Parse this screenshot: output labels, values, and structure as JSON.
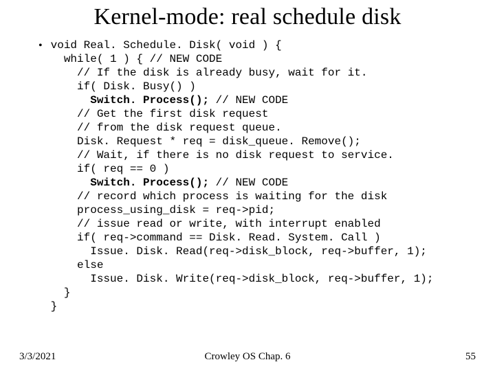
{
  "title": "Kernel-mode: real schedule disk",
  "bullet": "•",
  "code": {
    "l01": "void Real. Schedule. Disk( void ) {",
    "l02": "  while( 1 ) { // NEW CODE",
    "l03": "    // If the disk is already busy, wait for it.",
    "l04": "    if( Disk. Busy() )",
    "l05a": "      ",
    "l05b": "Switch. Process();",
    "l05c": " // NEW CODE",
    "l06": "    // Get the first disk request",
    "l07": "    // from the disk request queue.",
    "l08": "    Disk. Request * req = disk_queue. Remove();",
    "l09": "    // Wait, if there is no disk request to service.",
    "l10": "    if( req == 0 )",
    "l11a": "      ",
    "l11b": "Switch. Process();",
    "l11c": " // NEW CODE",
    "l12": "    // record which process is waiting for the disk",
    "l13": "    process_using_disk = req->pid;",
    "l14": "    // issue read or write, with interrupt enabled",
    "l15": "    if( req->command == Disk. Read. System. Call )",
    "l16": "      Issue. Disk. Read(req->disk_block, req->buffer, 1);",
    "l17": "    else",
    "l18": "      Issue. Disk. Write(req->disk_block, req->buffer, 1);",
    "l19": "  }",
    "l20": "}"
  },
  "footer": {
    "date": "3/3/2021",
    "center": "Crowley    OS     Chap. 6",
    "page": "55"
  }
}
